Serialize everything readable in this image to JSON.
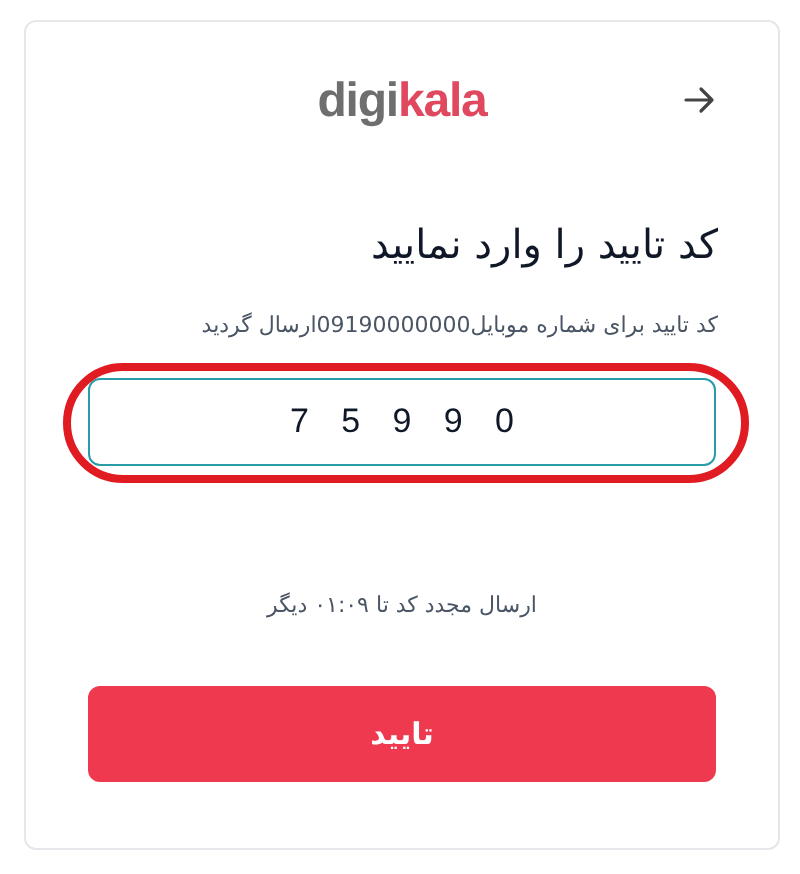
{
  "header": {
    "logo": {
      "text_main": "digi",
      "text_accent": "kala"
    }
  },
  "title": "کد تایید را وارد نمایید",
  "subtitle": "کد تایید برای شماره موبایل09190000000ارسال گردید",
  "code_field": {
    "value": "75990",
    "highlighted": true
  },
  "resend_timer": "ارسال مجدد کد تا ۰۱:۰۹ دیگر",
  "submit_button": "تایید"
}
